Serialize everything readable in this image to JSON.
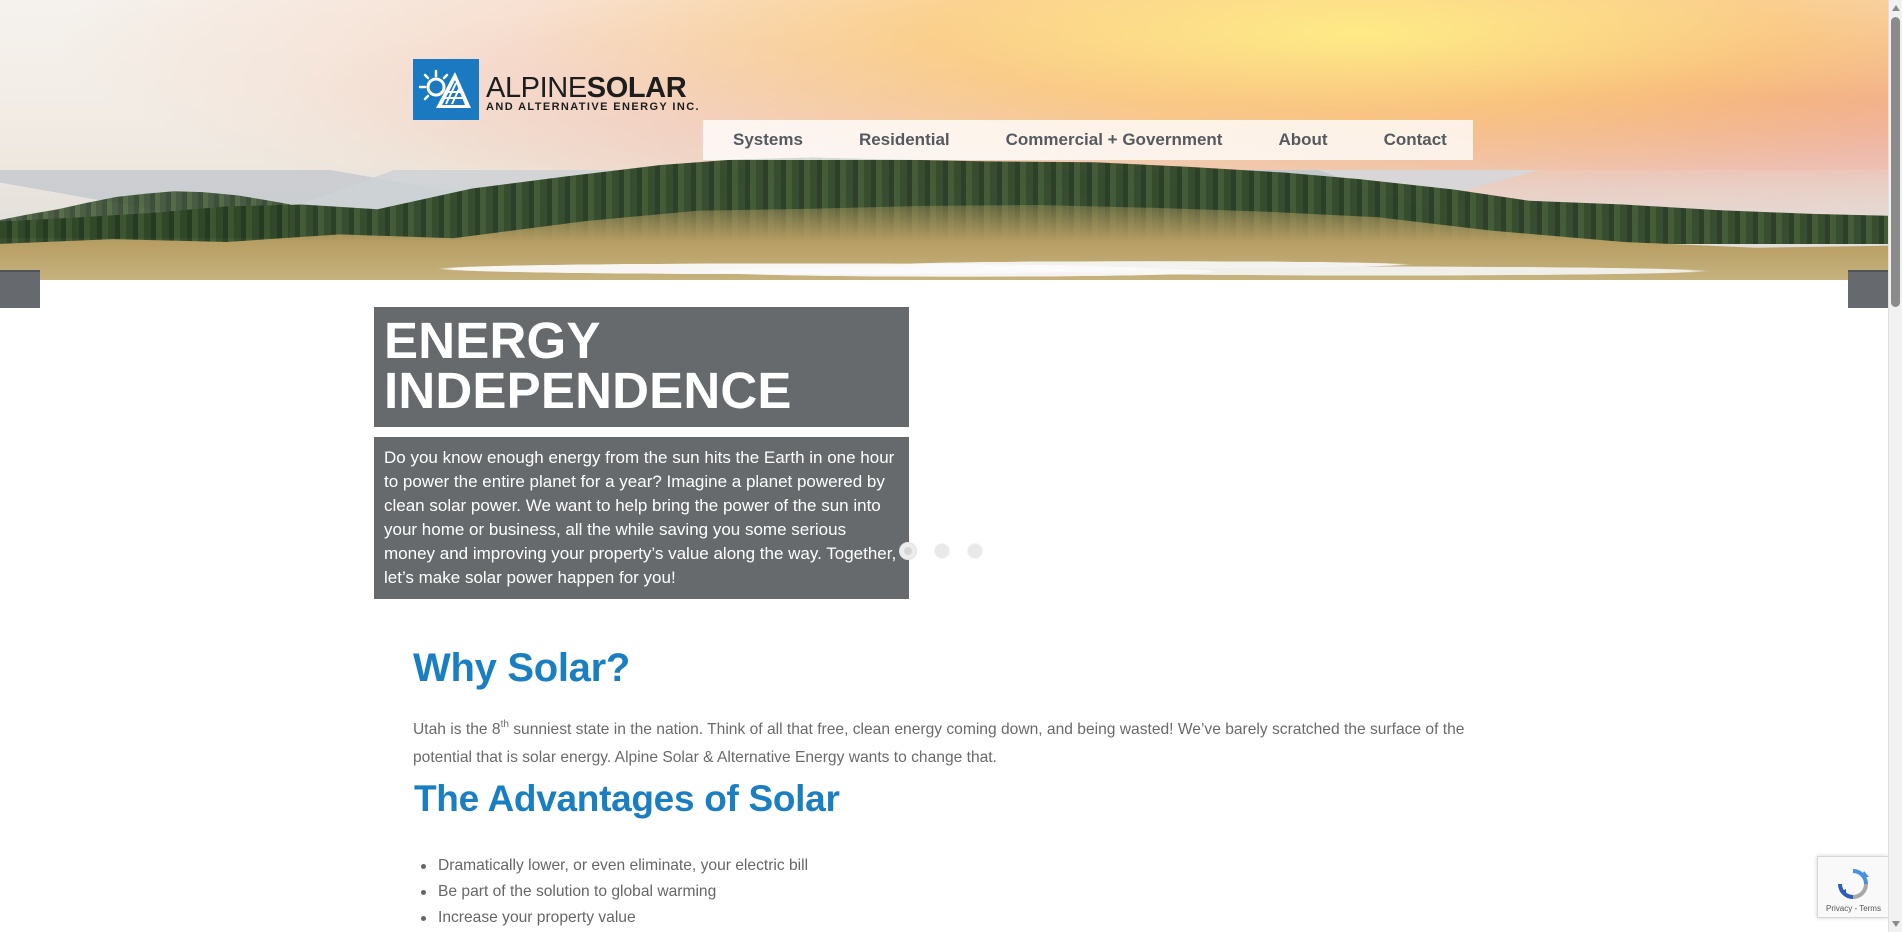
{
  "brand": {
    "name_part1": "ALPINE",
    "name_part2": "SOLAR",
    "subtitle": "AND ALTERNATIVE ENERGY INC.",
    "logo_icon": "solar-mountain-icon",
    "brand_blue": "#1a79c1"
  },
  "navigation": {
    "items": [
      {
        "label": "Systems"
      },
      {
        "label": "Residential"
      },
      {
        "label": "Commercial + Government"
      },
      {
        "label": "About"
      },
      {
        "label": "Contact"
      }
    ]
  },
  "hero": {
    "title_line1": "ENERGY",
    "title_line2": "INDEPENDENCE",
    "body": "Do you know enough energy from the sun hits the Earth in one hour to power the entire planet for a year? Imagine a planet powered by clean solar power. We want to help bring the power of the sun into your home or business, all the while saving you some serious money and improving your property’s value along the way. Together, let’s make solar power happen for you!",
    "dots": {
      "count": 3,
      "active_index": 0
    }
  },
  "content": {
    "why_solar_heading": "Why Solar?",
    "intro_prefix": "Utah is the 8",
    "intro_sup": "th",
    "intro_suffix": " sunniest state in the nation. Think of all that free, clean energy coming down, and being wasted! We’ve barely scratched the surface of the potential that is solar energy. Alpine Solar & Alternative Energy wants to change that.",
    "advantages_heading": "The Advantages of Solar",
    "advantages": [
      "Dramatically lower, or even eliminate, your electric bill",
      "Be part of the solution to global warming",
      "Increase your property value"
    ]
  },
  "recaptcha": {
    "icon": "recaptcha-icon",
    "text": "Privacy - Terms"
  },
  "colors": {
    "heading_blue": "#1a7ec3",
    "hero_box_gray": "#666a6d",
    "nav_text_gray": "#555a60",
    "body_text_gray": "#6a6a6a"
  }
}
